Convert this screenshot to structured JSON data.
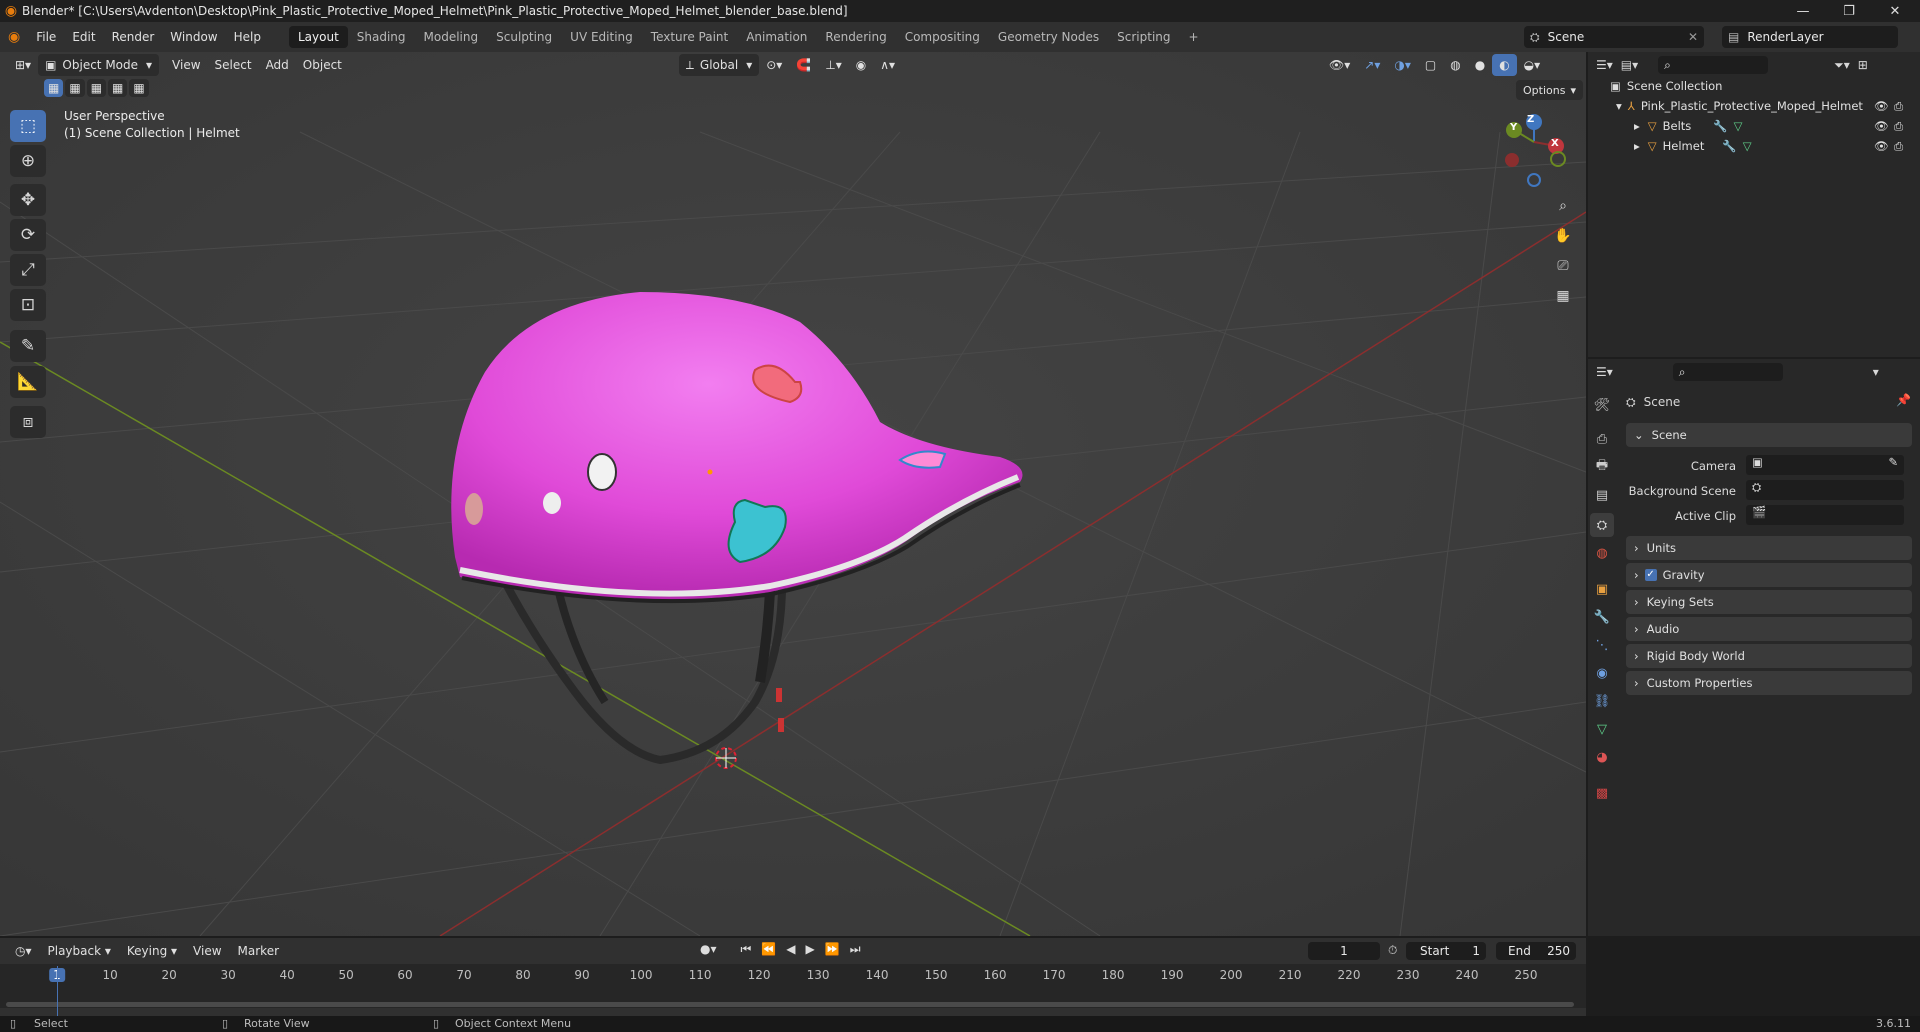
{
  "titlebar": {
    "title": "Blender* [C:\\Users\\Avdenton\\Desktop\\Pink_Plastic_Protective_Moped_Helmet\\Pink_Plastic_Protective_Moped_Helmet_blender_base.blend]"
  },
  "menu": [
    "File",
    "Edit",
    "Render",
    "Window",
    "Help"
  ],
  "workspaces": [
    "Layout",
    "Shading",
    "Modeling",
    "Sculpting",
    "UV Editing",
    "Texture Paint",
    "Animation",
    "Rendering",
    "Compositing",
    "Geometry Nodes",
    "Scripting"
  ],
  "active_workspace": "Layout",
  "scene_name": "Scene",
  "view_layer": "RenderLayer",
  "viewport": {
    "mode": "Object Mode",
    "menus": [
      "View",
      "Select",
      "Add",
      "Object"
    ],
    "orientation": "Global",
    "options_label": "Options",
    "overlay_title": "User Perspective",
    "overlay_subtitle": "(1) Scene Collection | Helmet",
    "helmet_color": "#e04ad8",
    "gizmo": {
      "x": "X",
      "y": "Y",
      "z": "Z"
    }
  },
  "outliner": {
    "root": "Scene Collection",
    "items": [
      {
        "name": "Pink_Plastic_Protective_Moped_Helmet"
      },
      {
        "name": "Belts"
      },
      {
        "name": "Helmet"
      }
    ]
  },
  "properties": {
    "context": "Scene",
    "panel": "Scene",
    "rows": [
      {
        "label": "Camera"
      },
      {
        "label": "Background Scene"
      },
      {
        "label": "Active Clip"
      }
    ],
    "subpanels": [
      "Units",
      "Gravity",
      "Keying Sets",
      "Audio",
      "Rigid Body World",
      "Custom Properties"
    ],
    "gravity_enabled": true
  },
  "timeline": {
    "menus": [
      "Playback",
      "Keying",
      "View",
      "Marker"
    ],
    "current_frame": "1",
    "start_label": "Start",
    "start": "1",
    "end_label": "End",
    "end": "250",
    "ticks": [
      "1",
      "10",
      "20",
      "30",
      "40",
      "50",
      "60",
      "70",
      "80",
      "90",
      "100",
      "110",
      "120",
      "130",
      "140",
      "150",
      "160",
      "170",
      "180",
      "190",
      "200",
      "210",
      "220",
      "230",
      "240",
      "250"
    ]
  },
  "statusbar": {
    "hints": [
      "Select",
      "Rotate View",
      "Object Context Menu"
    ],
    "version": "3.6.11"
  },
  "colors": {
    "accent": "#4772b3",
    "x_axis": "#8b2e2e",
    "y_axis": "#6b8a22"
  }
}
